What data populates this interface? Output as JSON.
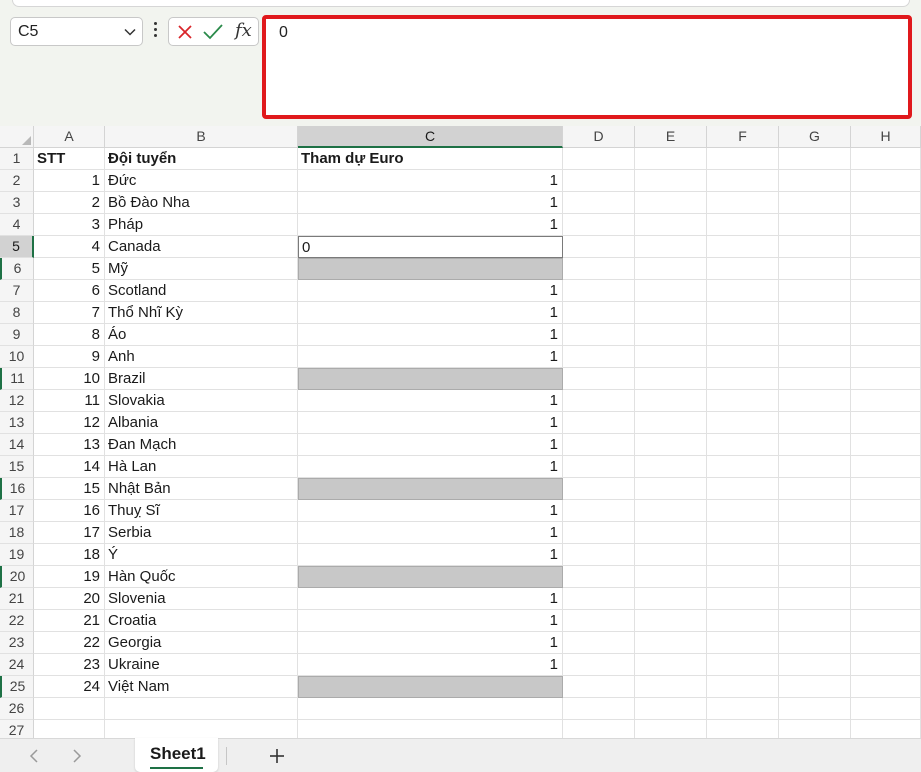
{
  "formula_bar": {
    "name_box": "C5",
    "func_icon": "fx",
    "formula_value": "0"
  },
  "grid": {
    "columns": [
      "A",
      "B",
      "C",
      "D",
      "E",
      "F",
      "G",
      "H"
    ],
    "selected_column": "C",
    "selected_row": 5,
    "marked_rows": [
      6,
      11,
      16,
      20,
      25
    ],
    "headers": [
      "STT",
      "Đội tuyển",
      "Tham dự Euro"
    ],
    "rows": [
      {
        "n": 2,
        "stt": "1",
        "team": "Đức",
        "euro": "1"
      },
      {
        "n": 3,
        "stt": "2",
        "team": "Bồ Đào Nha",
        "euro": "1"
      },
      {
        "n": 4,
        "stt": "3",
        "team": "Pháp",
        "euro": "1"
      },
      {
        "n": 5,
        "stt": "4",
        "team": "Canada",
        "euro": "0"
      },
      {
        "n": 6,
        "stt": "5",
        "team": "Mỹ",
        "euro": ""
      },
      {
        "n": 7,
        "stt": "6",
        "team": "Scotland",
        "euro": "1"
      },
      {
        "n": 8,
        "stt": "7",
        "team": "Thổ Nhĩ Kỳ",
        "euro": "1"
      },
      {
        "n": 9,
        "stt": "8",
        "team": "Áo",
        "euro": "1"
      },
      {
        "n": 10,
        "stt": "9",
        "team": "Anh",
        "euro": "1"
      },
      {
        "n": 11,
        "stt": "10",
        "team": "Brazil",
        "euro": ""
      },
      {
        "n": 12,
        "stt": "11",
        "team": "Slovakia",
        "euro": "1"
      },
      {
        "n": 13,
        "stt": "12",
        "team": "Albania",
        "euro": "1"
      },
      {
        "n": 14,
        "stt": "13",
        "team": "Đan Mạch",
        "euro": "1"
      },
      {
        "n": 15,
        "stt": "14",
        "team": "Hà Lan",
        "euro": "1"
      },
      {
        "n": 16,
        "stt": "15",
        "team": "Nhật Bản",
        "euro": ""
      },
      {
        "n": 17,
        "stt": "16",
        "team": "Thuỵ Sĩ",
        "euro": "1"
      },
      {
        "n": 18,
        "stt": "17",
        "team": "Serbia",
        "euro": "1"
      },
      {
        "n": 19,
        "stt": "18",
        "team": "Ý",
        "euro": "1"
      },
      {
        "n": 20,
        "stt": "19",
        "team": "Hàn Quốc",
        "euro": ""
      },
      {
        "n": 21,
        "stt": "20",
        "team": "Slovenia",
        "euro": "1"
      },
      {
        "n": 22,
        "stt": "21",
        "team": "Croatia",
        "euro": "1"
      },
      {
        "n": 23,
        "stt": "22",
        "team": "Georgia",
        "euro": "1"
      },
      {
        "n": 24,
        "stt": "23",
        "team": "Ukraine",
        "euro": "1"
      },
      {
        "n": 25,
        "stt": "24",
        "team": "Việt Nam",
        "euro": ""
      }
    ],
    "empty_rows": [
      26,
      27
    ]
  },
  "sheet_tabs": {
    "active": "Sheet1",
    "add_label": "+"
  },
  "colors": {
    "accent_green": "#1e7145",
    "highlight_red": "#e0191c",
    "gray_fill": "#c8c8c8"
  }
}
